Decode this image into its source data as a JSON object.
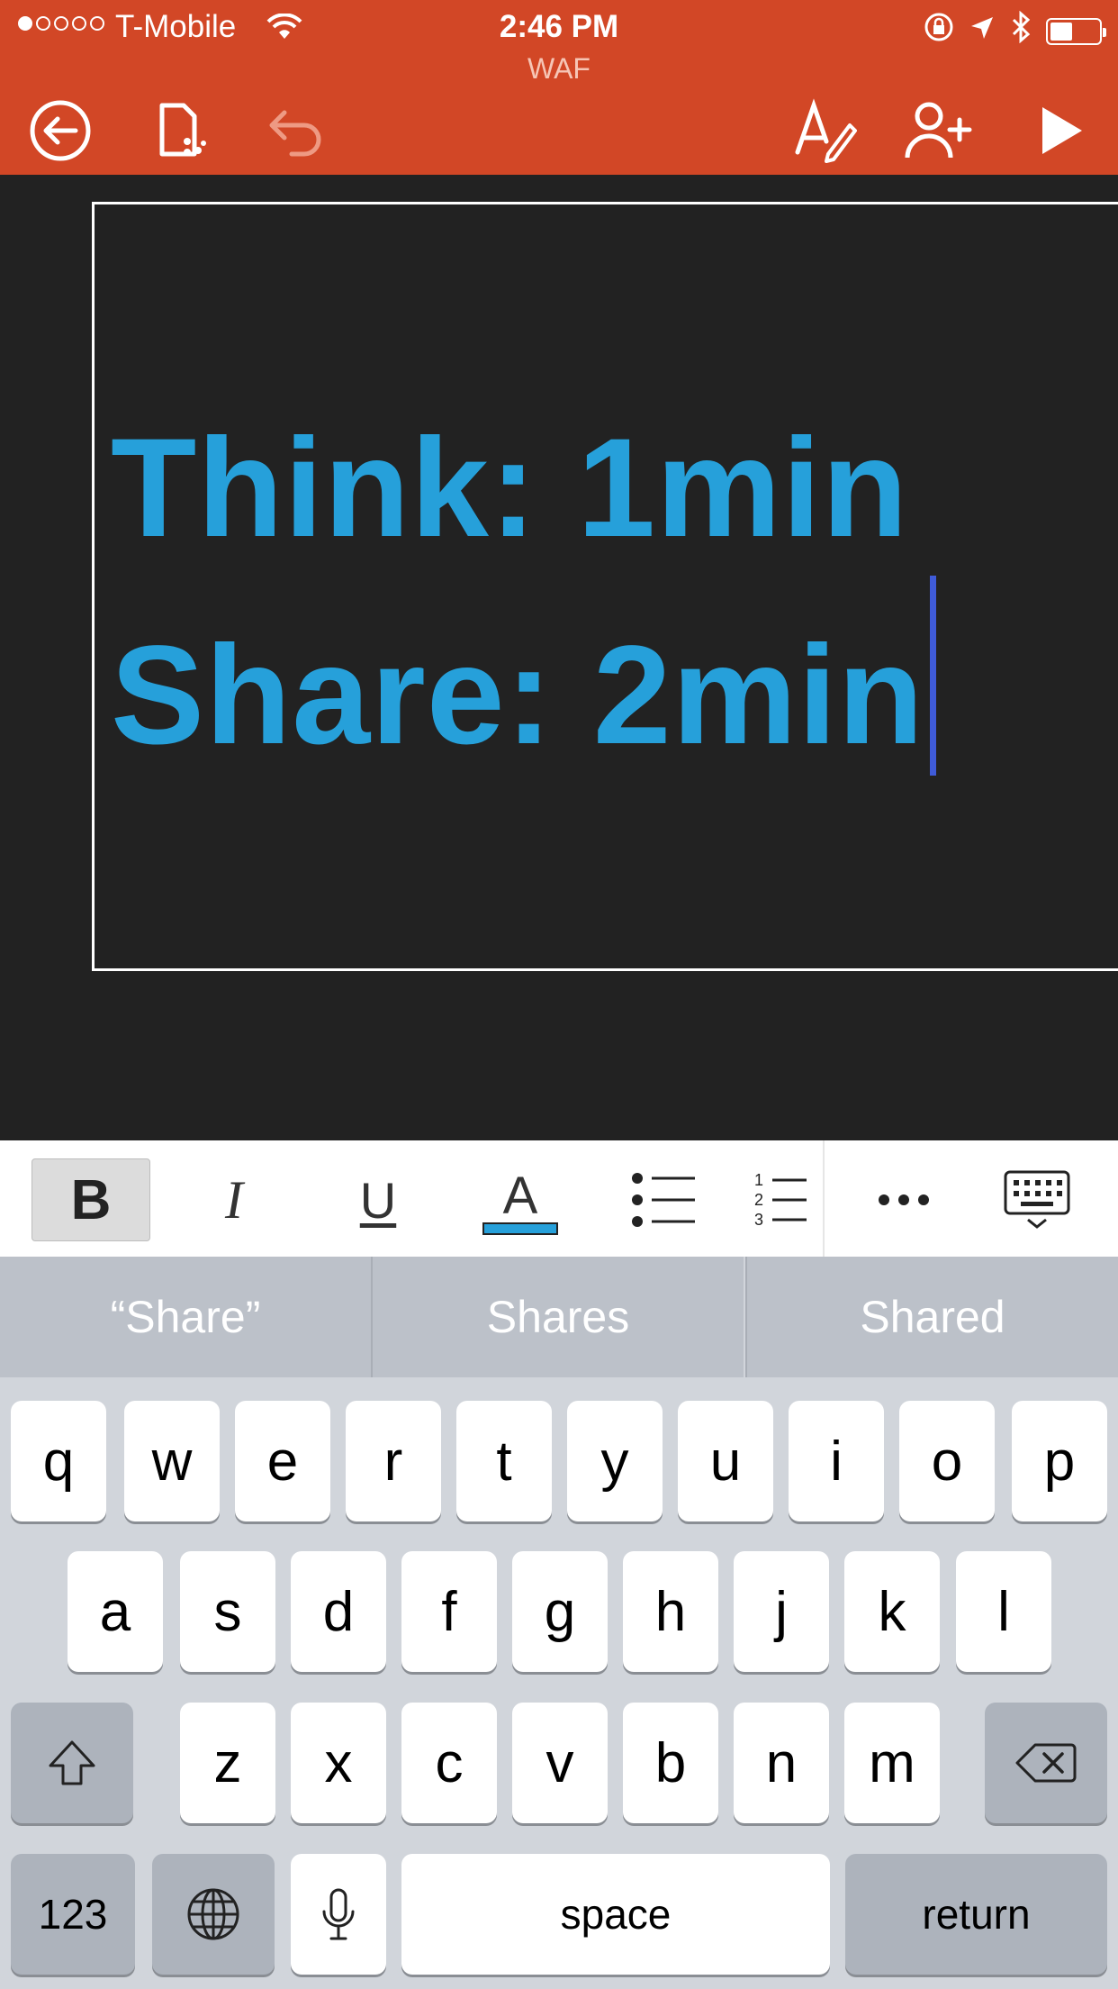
{
  "status_bar": {
    "carrier": "T-Mobile",
    "time": "2:46 PM"
  },
  "document": {
    "title": "WAF"
  },
  "toolbar_icons": [
    "back-icon",
    "file-icon",
    "undo-icon",
    "text-format-icon",
    "share-add-person-icon",
    "play-icon"
  ],
  "slide": {
    "line1": "Think: 1min",
    "line2": "Share: 2min",
    "text_color": "#26A0DA"
  },
  "format_bar": {
    "bold": "B",
    "italic": "I",
    "underline": "U",
    "font_color": "A",
    "numbered_list_digits": [
      "1",
      "2",
      "3"
    ]
  },
  "suggestions": [
    "“Share”",
    "Shares",
    "Shared"
  ],
  "keyboard": {
    "row1": [
      "q",
      "w",
      "e",
      "r",
      "t",
      "y",
      "u",
      "i",
      "o",
      "p"
    ],
    "row2": [
      "a",
      "s",
      "d",
      "f",
      "g",
      "h",
      "j",
      "k",
      "l"
    ],
    "row3": [
      "z",
      "x",
      "c",
      "v",
      "b",
      "n",
      "m"
    ],
    "numbers_label": "123",
    "space_label": "space",
    "return_label": "return"
  },
  "colors": {
    "header": "#D24726",
    "slide_bg": "#222222",
    "caret": "#3F5BD8"
  }
}
